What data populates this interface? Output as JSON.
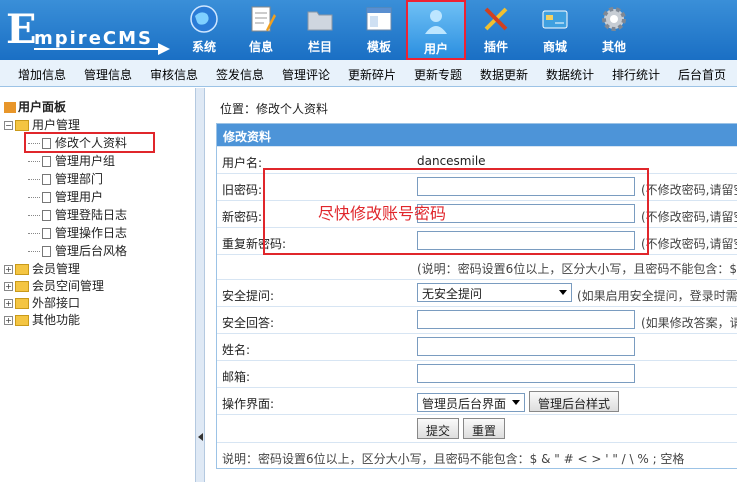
{
  "logo": {
    "big": "E",
    "rest": "mpireCMS"
  },
  "topnav": [
    {
      "label": "系统",
      "icon": "globe-icon"
    },
    {
      "label": "信息",
      "icon": "document-pen-icon"
    },
    {
      "label": "栏目",
      "icon": "folder-icon"
    },
    {
      "label": "模板",
      "icon": "window-template-icon"
    },
    {
      "label": "用户",
      "icon": "user-icon"
    },
    {
      "label": "插件",
      "icon": "tools-icon"
    },
    {
      "label": "商城",
      "icon": "card-icon"
    },
    {
      "label": "其他",
      "icon": "gear-icon"
    }
  ],
  "subnav": [
    "增加信息",
    "管理信息",
    "审核信息",
    "签发信息",
    "管理评论",
    "更新碎片",
    "更新专题",
    "数据更新",
    "数据统计",
    "排行统计",
    "后台首页"
  ],
  "sidebar": {
    "title": "用户面板",
    "group": "用户管理",
    "children": [
      "修改个人资料",
      "管理用户组",
      "管理部门",
      "管理用户",
      "管理登陆日志",
      "管理操作日志",
      "管理后台风格"
    ],
    "others": [
      "会员管理",
      "会员空间管理",
      "外部接口",
      "其他功能"
    ]
  },
  "breadcrumb": "位置：修改个人资料",
  "form": {
    "header": "修改资料",
    "username_label": "用户名:",
    "username_value": "dancesmile",
    "old_pwd_label": "旧密码:",
    "new_pwd_label": "新密码:",
    "repeat_pwd_label": "重复新密码:",
    "pwd_note": "(不修改密码,请留空",
    "pwd_rule_note": "(说明：密码设置6位以上，区分大小写，且密码不能包含：$",
    "question_label": "安全提问:",
    "question_value": "无安全提问",
    "question_note": "(如果启用安全提问，登录时需",
    "answer_label": "安全回答:",
    "answer_note": "(如果修改答案，请",
    "name_label": "姓名:",
    "email_label": "邮箱:",
    "ui_label": "操作界面:",
    "ui_value": "管理员后台界面",
    "ui_style_button": "管理后台样式",
    "submit_button": "提交",
    "reset_button": "重置",
    "footer_note": "说明：密码设置6位以上，区分大小写，且密码不能包含：$ & \" # < > ' \" / \\ % ; 空格"
  },
  "annotation": "尽快修改账号密码"
}
